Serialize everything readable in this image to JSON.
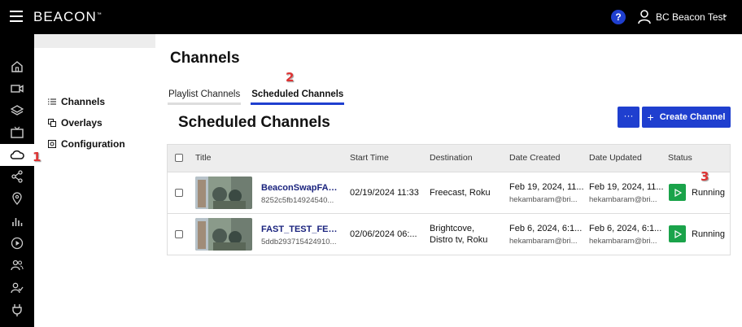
{
  "app": {
    "brand": "BEACON",
    "brand_mark": "™",
    "help": "?",
    "user": "BC Beacon Test"
  },
  "rail": {
    "icons": [
      "home-icon",
      "video-icon",
      "layers-icon",
      "tv-icon",
      "cloud-icon",
      "share-icon",
      "pin-icon",
      "analytics-icon",
      "play-icon",
      "users-icon",
      "user-check-icon",
      "plug-icon"
    ],
    "active": "cloud-icon"
  },
  "subnav": {
    "items": [
      {
        "label": "Channels",
        "icon": "list-icon"
      },
      {
        "label": "Overlays",
        "icon": "overlay-icon"
      },
      {
        "label": "Configuration",
        "icon": "config-icon"
      }
    ]
  },
  "page": {
    "title": "Channels"
  },
  "tabs": [
    {
      "label": "Playlist Channels",
      "active": false
    },
    {
      "label": "Scheduled Channels",
      "active": true
    }
  ],
  "section": {
    "title": "Scheduled Channels",
    "more_label": "···",
    "create_label": "Create Channel",
    "create_icon": "+"
  },
  "table": {
    "columns": [
      "Title",
      "Start Time",
      "Destination",
      "Date Created",
      "Date Updated",
      "Status"
    ],
    "rows": [
      {
        "title": "BeaconSwapFAS...",
        "id": "8252c5fb14924540...",
        "start": "02/19/2024 11:33",
        "destination_1": "Freecast, Roku",
        "destination_2": "",
        "created": "Feb 19, 2024, 11...",
        "created_by": "hekambaram@bri...",
        "updated": "Feb 19, 2024, 11...",
        "updated_by": "hekambaram@bri...",
        "status": "Running"
      },
      {
        "title": "FAST_TEST_FEB_6",
        "id": "5ddb293715424910...",
        "start": "02/06/2024 06:...",
        "destination_1": "Brightcove,",
        "destination_2": "Distro tv, Roku",
        "created": "Feb 6, 2024, 6:1...",
        "created_by": "hekambaram@bri...",
        "updated": "Feb 6, 2024, 6:1...",
        "updated_by": "hekambaram@bri...",
        "status": "Running"
      }
    ]
  },
  "annotations": [
    "1",
    "2",
    "3"
  ],
  "colors": {
    "accent": "#1f3fcf",
    "running": "#1aa34a",
    "link": "#1a237e",
    "marker": "#dd3333"
  }
}
